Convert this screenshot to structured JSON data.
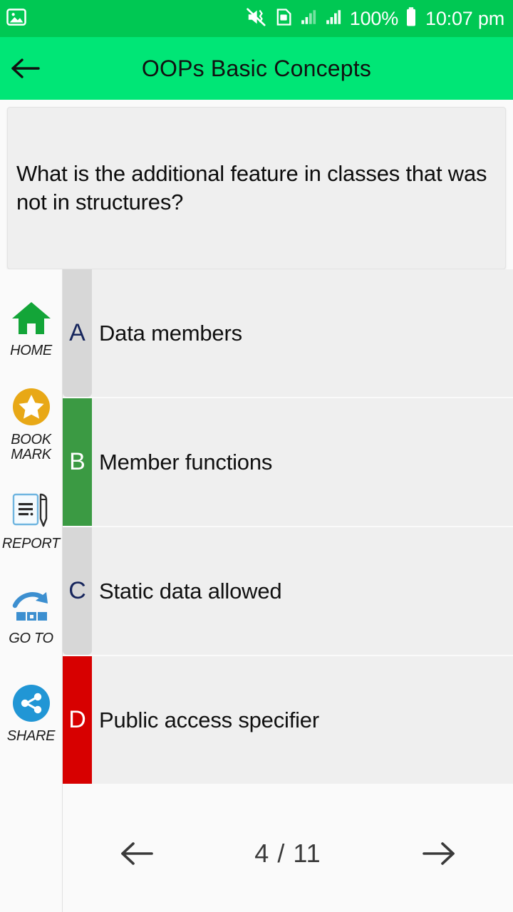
{
  "status_bar": {
    "notification_icon": "image-icon",
    "icons": [
      "mute-vibrate-icon",
      "sim-card-icon",
      "signal-bars-icon-1",
      "signal-bars-icon-2"
    ],
    "battery_percent": "100%",
    "battery_icon": "battery-full-icon",
    "time": "10:07 pm",
    "background_color": "#00C853"
  },
  "app_bar": {
    "back_icon": "back-arrow-icon",
    "title": "OOPs Basic Concepts",
    "background_color": "#00E676"
  },
  "question": {
    "text": "What is the additional feature in classes that was not in structures?"
  },
  "sidebar": {
    "items": [
      {
        "icon": "home-icon",
        "label": "HOME",
        "color": "#13A538"
      },
      {
        "icon": "bookmark-star-icon",
        "label": "BOOK\nMARK",
        "color": "#E8A816"
      },
      {
        "icon": "report-document-pen-icon",
        "label": "REPORT",
        "color": "#3C8FD0"
      },
      {
        "icon": "goto-arrow-icon",
        "label": "GO TO",
        "color": "#3C8FD0"
      },
      {
        "icon": "share-icon",
        "label": "SHARE",
        "color": "#2196D5"
      }
    ]
  },
  "options": [
    {
      "letter": "A",
      "text": "Data members",
      "state": "neutral",
      "badge_color": "#D7D7D7",
      "letter_color": "#16255c"
    },
    {
      "letter": "B",
      "text": "Member functions",
      "state": "correct",
      "badge_color": "#3B9A43",
      "letter_color": "#FFFFFF"
    },
    {
      "letter": "C",
      "text": "Static data allowed",
      "state": "neutral",
      "badge_color": "#D7D7D7",
      "letter_color": "#16255c"
    },
    {
      "letter": "D",
      "text": "Public access specifier",
      "state": "wrong",
      "badge_color": "#D70000",
      "letter_color": "#FFFFFF"
    }
  ],
  "pager": {
    "prev_icon": "arrow-left-icon",
    "next_icon": "arrow-right-icon",
    "count": "4 / 11",
    "current": 4,
    "total": 11
  }
}
